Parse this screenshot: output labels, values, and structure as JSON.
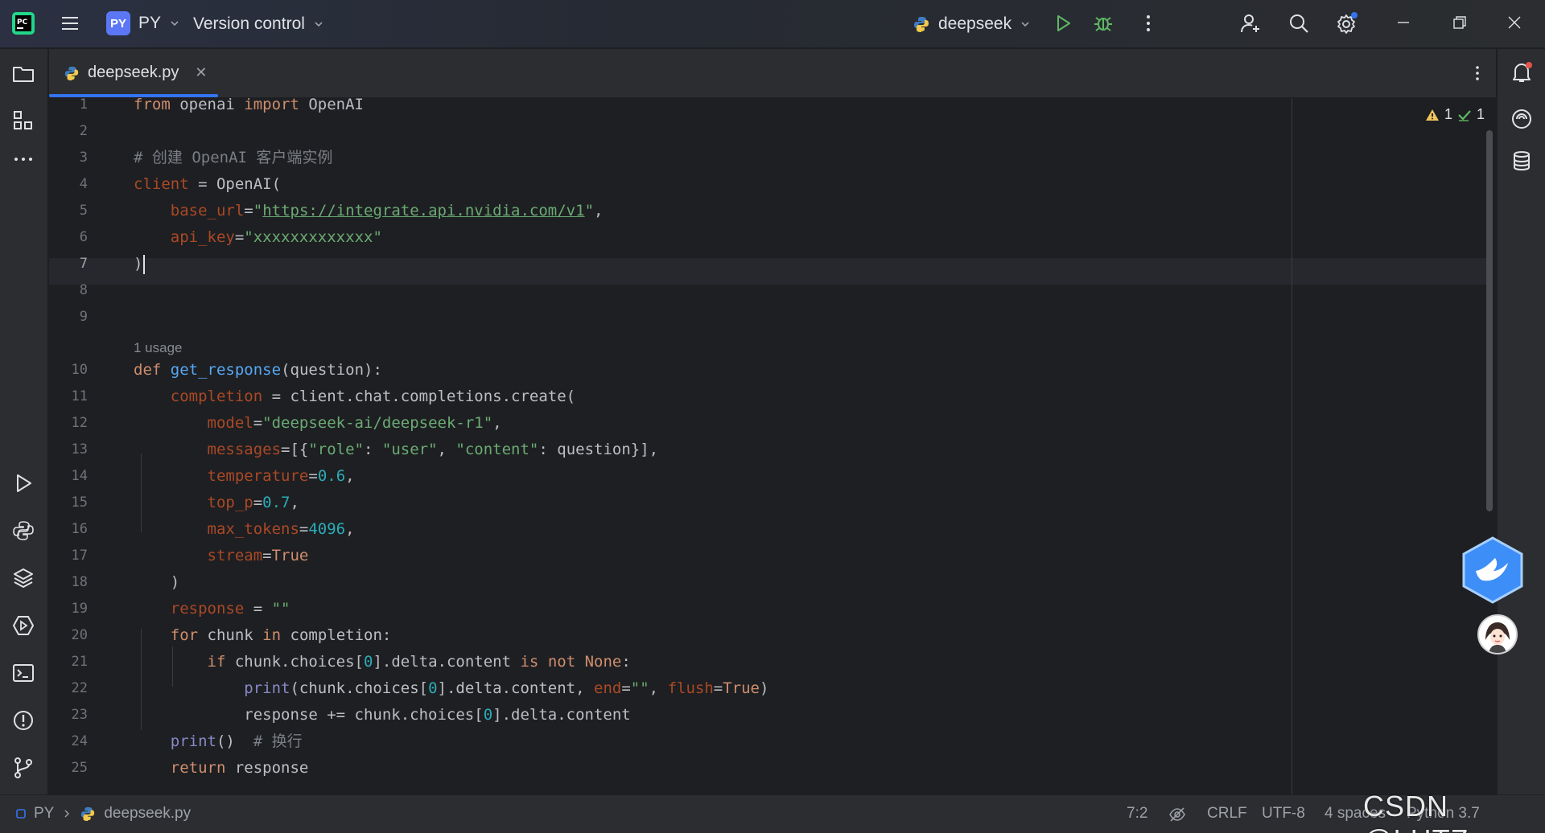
{
  "titlebar": {
    "project_badge": "PY",
    "project_name": "PY",
    "vcs_label": "Version control",
    "run_config": "deepseek"
  },
  "tabs": [
    {
      "label": "deepseek.py",
      "active": true
    }
  ],
  "editor": {
    "line_numbers": [
      "1",
      "2",
      "3",
      "4",
      "5",
      "6",
      "7",
      "8",
      "9",
      "10",
      "11",
      "12",
      "13",
      "14",
      "15",
      "16",
      "17",
      "18",
      "19",
      "20",
      "21",
      "22",
      "23",
      "24",
      "25"
    ],
    "current_line": "7",
    "usage_hint": "1 usage",
    "inspections": {
      "warnings": "1",
      "ok": "1"
    },
    "lines": [
      "from openai import OpenAI",
      "",
      "# 创建 OpenAI 客户端实例",
      "client = OpenAI(",
      "    base_url=\"https://integrate.api.nvidia.com/v1\",",
      "    api_key=\"xxxxxxxxxxxxx\"",
      ")",
      "",
      "",
      "def get_response(question):",
      "    completion = client.chat.completions.create(",
      "        model=\"deepseek-ai/deepseek-r1\",",
      "        messages=[{\"role\": \"user\", \"content\": question}],",
      "        temperature=0.6,",
      "        top_p=0.7,",
      "        max_tokens=4096,",
      "        stream=True",
      "    )",
      "    response = \"\"",
      "    for chunk in completion:",
      "        if chunk.choices[0].delta.content is not None:",
      "            print(chunk.choices[0].delta.content, end=\"\", flush=True)",
      "            response += chunk.choices[0].delta.content",
      "    print()  # 换行",
      "    return response"
    ]
  },
  "statusbar": {
    "project": "PY",
    "file": "deepseek.py",
    "position": "7:2",
    "line_sep": "CRLF",
    "encoding": "UTF-8",
    "indent": "4 spaces",
    "interpreter": "Python 3.7"
  },
  "watermark": "CSDN @LHTZ",
  "colors": {
    "accent": "#3574f0",
    "keyword": "#cf8e6d",
    "string": "#6aab73",
    "function": "#56a8f5",
    "param": "#aa4926",
    "number": "#2aacb8"
  }
}
